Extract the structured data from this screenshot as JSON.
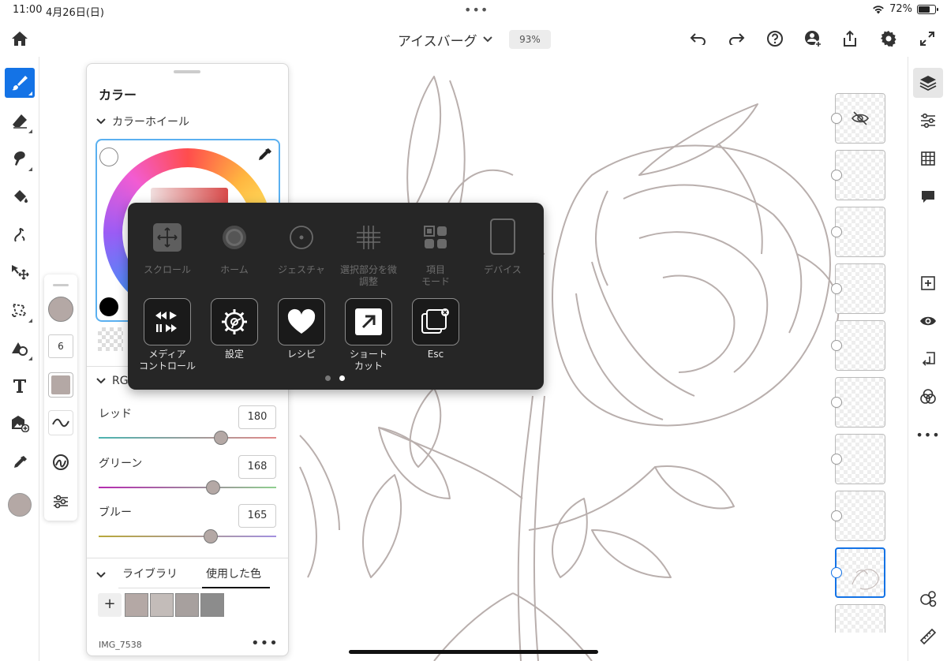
{
  "status": {
    "time": "11:00",
    "date": "4月26日(日)",
    "battery": "72%",
    "battery_level": 0.72
  },
  "header": {
    "doc_title": "アイスバーグ",
    "zoom": "93%"
  },
  "panel": {
    "title": "カラー",
    "wheel_section": "カラーホイール",
    "rgb_section": "RGB",
    "red_label": "レッド",
    "red_value": "180",
    "green_label": "グリーン",
    "green_value": "168",
    "blue_label": "ブルー",
    "blue_value": "165",
    "library_tab": "ライブラリ",
    "used_tab": "使用した色",
    "add": "+",
    "recent_colors": [
      "#b4a8a5",
      "#c3bcb9",
      "#a7a09e",
      "#8c8c8c"
    ],
    "image_name": "IMG_7538",
    "more": "•••"
  },
  "brush": {
    "size": "6",
    "color": "#b4a8a5"
  },
  "gesture_menu": {
    "row1": [
      "スクロール",
      "ホーム",
      "ジェスチャ",
      "選択部分を微\n調整",
      "項目\nモード",
      "デバイス"
    ],
    "media": "メディア\nコントロール",
    "settings": "設定",
    "recipes": "レシピ",
    "shortcut": "ショート\nカット",
    "esc": "Esc",
    "page": 2,
    "pages": 2
  },
  "colors": {
    "accent": "#1473e6",
    "current_color": "#b4a8a5",
    "line_art": "#b9afad"
  },
  "right_more": "•••"
}
